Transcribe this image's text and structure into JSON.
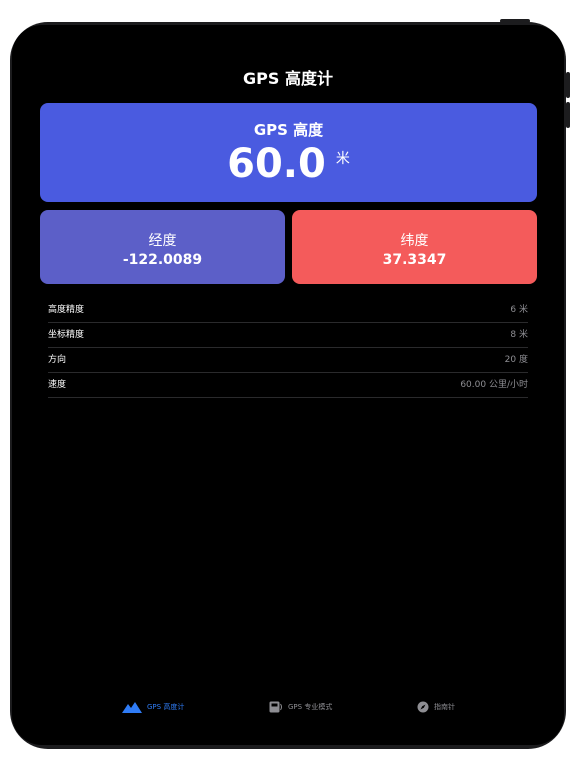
{
  "header": {
    "title": "GPS 高度计"
  },
  "altitude": {
    "label": "GPS 高度",
    "value": "60.0",
    "unit": "米"
  },
  "longitude": {
    "label": "经度",
    "value": "-122.0089"
  },
  "latitude": {
    "label": "纬度",
    "value": "37.3347"
  },
  "details": [
    {
      "label": "高度精度",
      "value": "6 米"
    },
    {
      "label": "坐标精度",
      "value": "8 米"
    },
    {
      "label": "方向",
      "value": "20 度"
    },
    {
      "label": "速度",
      "value": "60.00 公里/小时"
    }
  ],
  "tabbar": {
    "items": [
      {
        "label": "GPS 高度计",
        "icon": "mountain-icon",
        "active": true
      },
      {
        "label": "GPS 专业模式",
        "icon": "pro-mode-icon",
        "active": false
      },
      {
        "label": "指南针",
        "icon": "compass-icon",
        "active": false
      }
    ]
  },
  "colors": {
    "altitude_card": "#4a5be0",
    "longitude_card": "#5c5fc8",
    "latitude_card": "#f45b5b",
    "accent": "#2f7cf6"
  }
}
